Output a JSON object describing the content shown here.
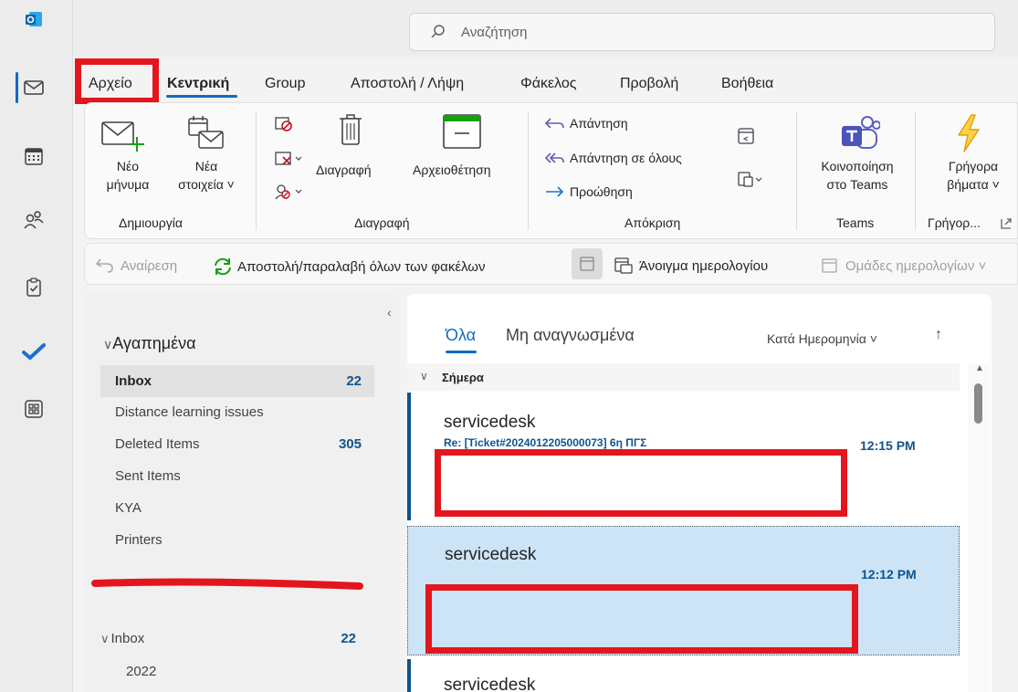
{
  "search": {
    "placeholder": "Αναζήτηση"
  },
  "tabs": [
    {
      "label": "Αρχείο"
    },
    {
      "label": "Κεντρική"
    },
    {
      "label": "Group"
    },
    {
      "label": "Αποστολή / Λήψη"
    },
    {
      "label": "Φάκελος"
    },
    {
      "label": "Προβολή"
    },
    {
      "label": "Βοήθεια"
    }
  ],
  "ribbon": {
    "new_message": [
      "Νέο",
      "μήνυμα"
    ],
    "new_items": [
      "Νέα",
      "στοιχεία ˅"
    ],
    "delete": "Διαγραφή",
    "archive": "Αρχειοθέτηση",
    "reply": "Απάντηση",
    "reply_all": "Απάντηση σε όλους",
    "forward": "Προώθηση",
    "share_teams": [
      "Κοινοποίηση",
      "στο Teams"
    ],
    "quick_steps": [
      "Γρήγορα",
      "βήματα ˅"
    ],
    "groups": {
      "create": "Δημιουργία",
      "delete": "Διαγραφή",
      "respond": "Απόκριση",
      "teams": "Teams",
      "quick": "Γρήγορ..."
    }
  },
  "quickbar": {
    "undo": "Αναίρεση",
    "send_receive": "Αποστολή/παραλαβή όλων των φακέλων",
    "open_calendar": "Άνοιγμα ημερολογίου",
    "calendar_groups": "Ομάδες ημερολογίων ˅"
  },
  "folders": {
    "favorites": "Αγαπημένα",
    "items": [
      {
        "label": "Inbox",
        "count": "22"
      },
      {
        "label": "Distance learning issues",
        "count": ""
      },
      {
        "label": "Deleted Items",
        "count": "305"
      },
      {
        "label": "Sent Items",
        "count": ""
      },
      {
        "label": "KYA",
        "count": ""
      },
      {
        "label": "Printers",
        "count": ""
      }
    ],
    "account_inbox": {
      "label": "Inbox",
      "count": "22"
    },
    "account_sub": "2022"
  },
  "list": {
    "tab_all": "Όλα",
    "tab_unread": "Μη αναγνωσμένα",
    "sort": "Κατά Ημερομηνία ˅",
    "group_today": "Σήμερα",
    "messages": [
      {
        "from": "servicedesk",
        "subject": "Re: [Ticket#2024012205000073] 6η ΠΓΣ",
        "time": "12:15 PM"
      },
      {
        "from": "servicedesk",
        "time": "12:12 PM"
      },
      {
        "from": "servicedesk"
      }
    ]
  },
  "colors": {
    "accent": "#0f6cbd",
    "highlight": "#e3161d",
    "selected": "#cce4f6"
  }
}
